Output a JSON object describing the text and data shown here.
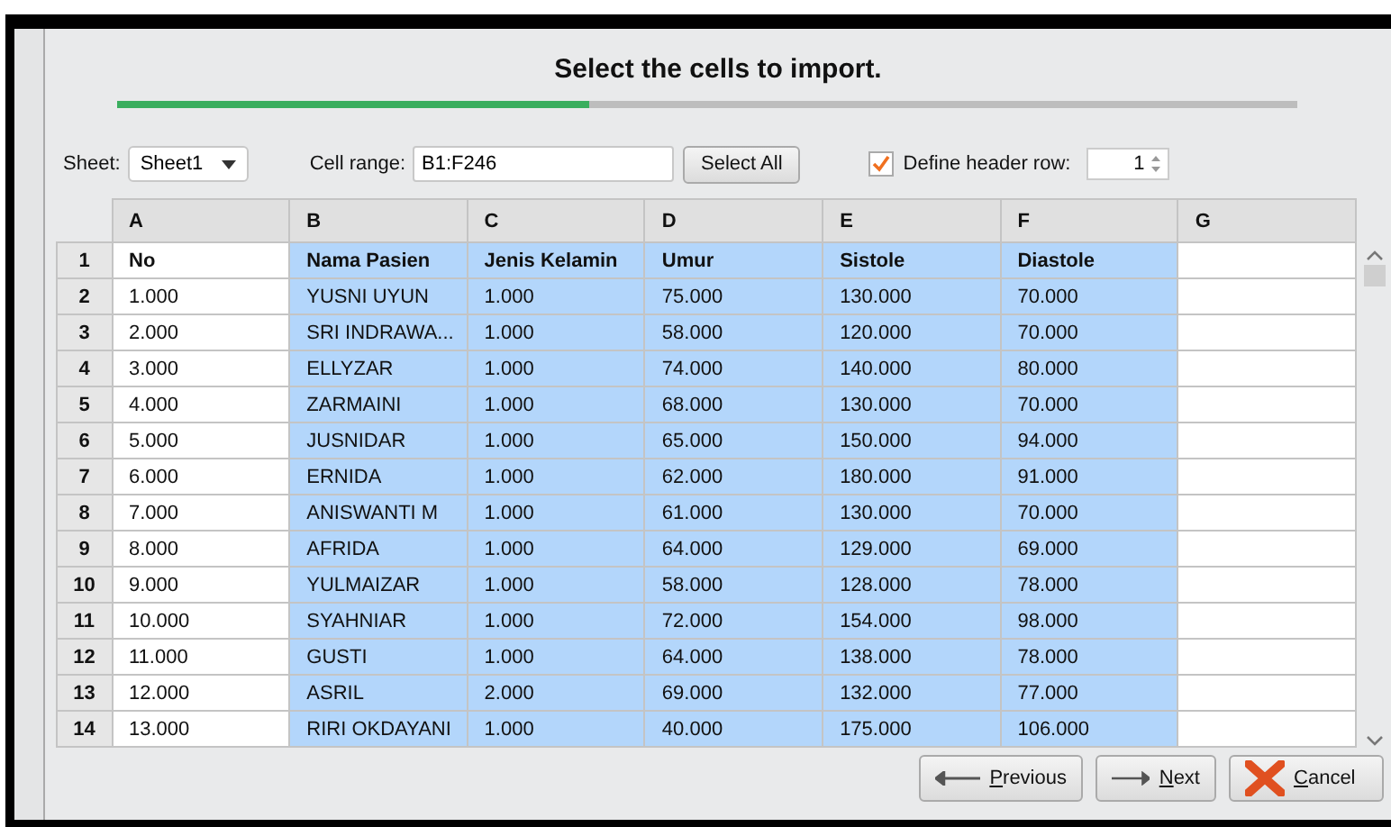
{
  "title": "Select the cells to import.",
  "progress": {
    "level": 0.4
  },
  "sheet": {
    "label": "Sheet:",
    "value": "Sheet1"
  },
  "cell_range": {
    "label": "Cell range:",
    "value": "B1:F246"
  },
  "select_all": "Select All",
  "header_row": {
    "label": "Define header row:",
    "checked": true,
    "value": "1"
  },
  "columns": [
    {
      "letter": "A",
      "selected": false
    },
    {
      "letter": "B",
      "selected": true
    },
    {
      "letter": "C",
      "selected": true
    },
    {
      "letter": "D",
      "selected": true
    },
    {
      "letter": "E",
      "selected": true
    },
    {
      "letter": "F",
      "selected": true
    },
    {
      "letter": "G",
      "selected": false
    }
  ],
  "rows": [
    {
      "number": "1",
      "header": true,
      "cells": [
        "No",
        "Nama Pasien",
        "Jenis Kelamin",
        "Umur",
        "Sistole",
        "Diastole"
      ]
    },
    {
      "number": "2",
      "header": false,
      "cells": [
        "1.000",
        "YUSNI UYUN",
        "1.000",
        "75.000",
        "130.000",
        "70.000"
      ]
    },
    {
      "number": "3",
      "header": false,
      "cells": [
        "2.000",
        "SRI INDRAWA...",
        "1.000",
        "58.000",
        "120.000",
        "70.000"
      ]
    },
    {
      "number": "4",
      "header": false,
      "cells": [
        "3.000",
        "ELLYZAR",
        "1.000",
        "74.000",
        "140.000",
        "80.000"
      ]
    },
    {
      "number": "5",
      "header": false,
      "cells": [
        "4.000",
        "ZARMAINI",
        "1.000",
        "68.000",
        "130.000",
        "70.000"
      ]
    },
    {
      "number": "6",
      "header": false,
      "cells": [
        "5.000",
        "JUSNIDAR",
        "1.000",
        "65.000",
        "150.000",
        "94.000"
      ]
    },
    {
      "number": "7",
      "header": false,
      "cells": [
        "6.000",
        "ERNIDA",
        "1.000",
        "62.000",
        "180.000",
        "91.000"
      ]
    },
    {
      "number": "8",
      "header": false,
      "cells": [
        "7.000",
        "ANISWANTI M",
        "1.000",
        "61.000",
        "130.000",
        "70.000"
      ]
    },
    {
      "number": "9",
      "header": false,
      "cells": [
        "8.000",
        "AFRIDA",
        "1.000",
        "64.000",
        "129.000",
        "69.000"
      ]
    },
    {
      "number": "10",
      "header": false,
      "cells": [
        "9.000",
        "YULMAIZAR",
        "1.000",
        "58.000",
        "128.000",
        "78.000"
      ]
    },
    {
      "number": "11",
      "header": false,
      "cells": [
        "10.000",
        "SYAHNIAR",
        "1.000",
        "72.000",
        "154.000",
        "98.000"
      ]
    },
    {
      "number": "12",
      "header": false,
      "cells": [
        "11.000",
        "GUSTI",
        "1.000",
        "64.000",
        "138.000",
        "78.000"
      ]
    },
    {
      "number": "13",
      "header": false,
      "cells": [
        "12.000",
        "ASRIL",
        "2.000",
        "69.000",
        "132.000",
        "77.000"
      ]
    },
    {
      "number": "14",
      "header": false,
      "cells": [
        "13.000",
        "RIRI OKDAYANI",
        "1.000",
        "40.000",
        "175.000",
        "106.000"
      ]
    }
  ],
  "buttons": [
    {
      "kind": "previous",
      "label": "Previous"
    },
    {
      "kind": "next",
      "label": "Next"
    },
    {
      "kind": "cancel",
      "label": "Cancel"
    }
  ]
}
